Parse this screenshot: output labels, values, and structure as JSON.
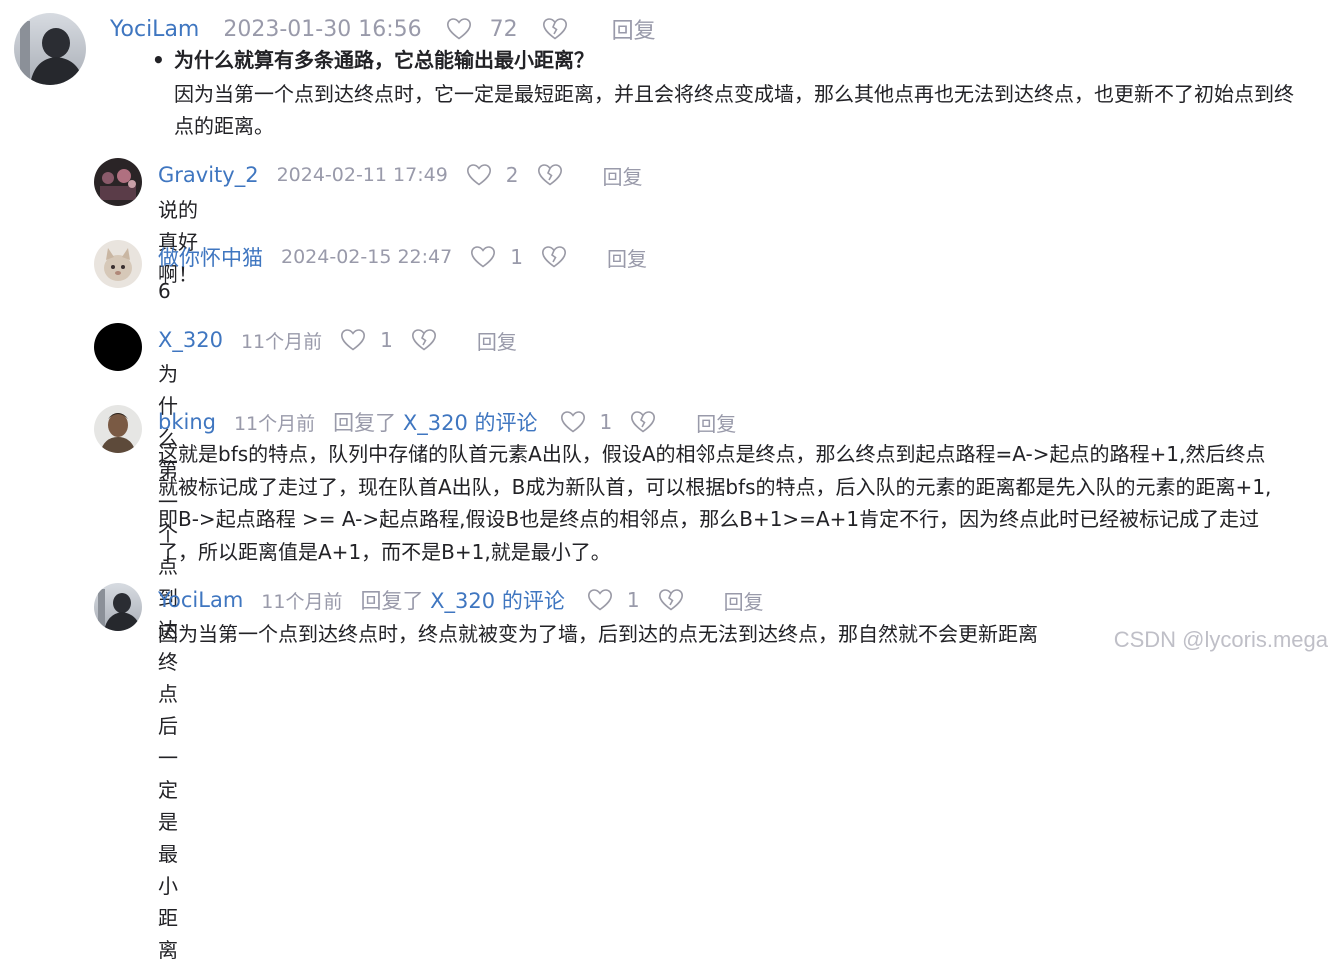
{
  "comments": {
    "top": {
      "username": "YociLam",
      "time": "2023-01-30 16:56",
      "likes": "72",
      "reply_label": "回复",
      "bullet_title": "为什么就算有多条通路，它总能输出最小距离？",
      "body": "因为当第一个点到达终点时，它一定是最短距离，并且会将终点变成墙，那么其他点再也无法到达终点，也更新不了初始点到终点的距离。"
    },
    "replies": [
      {
        "username": "Gravity_2",
        "time": "2024-02-11 17:49",
        "likes": "2",
        "reply_label": "回复",
        "content": "说的真好啊！"
      },
      {
        "username": "做你怀中猫",
        "time": "2024-02-15 22:47",
        "likes": "1",
        "reply_label": "回复",
        "content": "6"
      },
      {
        "username": "X_320",
        "time": "11个月前",
        "likes": "1",
        "reply_label": "回复",
        "content": "为什么第一个点到达终点后一定是最小距离"
      },
      {
        "username": "bking",
        "time": "11个月前",
        "replyto_prefix": "回复了",
        "replyto_target": "X_320 的评论",
        "likes": "1",
        "reply_label": "回复",
        "content": "这就是bfs的特点，队列中存储的队首元素A出队，假设A的相邻点是终点，那么终点到起点路程=A->起点的路程+1,然后终点就被标记成了走过了，现在队首A出队，B成为新队首，可以根据bfs的特点，后入队的元素的距离都是先入队的元素的距离+1,即B->起点路程 >= A->起点路程,假设B也是终点的相邻点，那么B+1>=A+1肯定不行，因为终点此时已经被标记成了走过了，所以距离值是A+1，而不是B+1,就是最小了。"
      },
      {
        "username": "YociLam",
        "time": "11个月前",
        "replyto_prefix": "回复了",
        "replyto_target": "X_320 的评论",
        "likes": "1",
        "reply_label": "回复",
        "content": "因为当第一个点到达终点时，终点就被变为了墙，后到达的点无法到达终点，那自然就不会更新距离"
      }
    ]
  },
  "watermark": "CSDN @lycoris.mega",
  "colors": {
    "link": "#3f76c0",
    "muted": "#999aaa",
    "text": "#222226"
  },
  "icons": {
    "like": "heart-outline-icon",
    "dislike": "broken-heart-icon"
  }
}
